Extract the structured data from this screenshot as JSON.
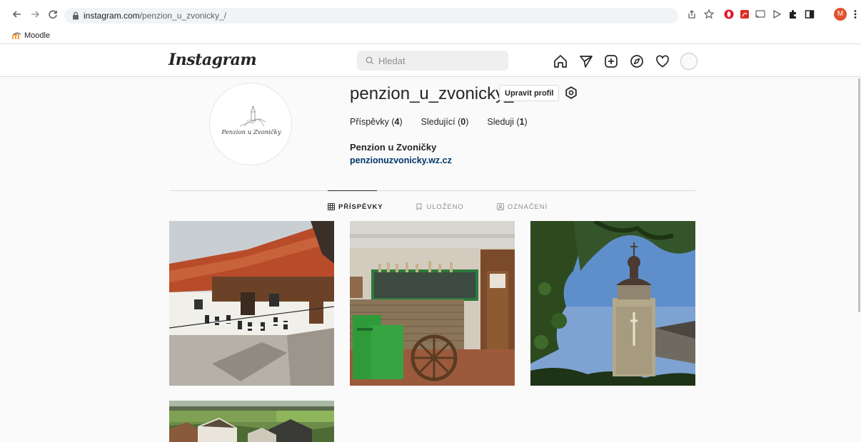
{
  "browser": {
    "url_domain": "instagram.com",
    "url_path": "/penzion_u_zvonicky_/",
    "bookmark_label": "Moodle",
    "profile_initial": "M"
  },
  "instagram": {
    "logo": "Instagram",
    "search_placeholder": "Hledat",
    "nav_icons": [
      "home-icon",
      "direct-icon",
      "new-post-icon",
      "explore-icon",
      "activity-icon",
      "profile-avatar"
    ]
  },
  "profile": {
    "username": "penzion_u_zvonicky_",
    "edit_button_label": "Upravit profil",
    "avatar_text": "Penzion u Zvoničky",
    "stats": {
      "posts_label": "Příspěvky",
      "posts_count": "4",
      "followers_label": "Sledující",
      "followers_count": "0",
      "following_label": "Sleduji",
      "following_count": "1"
    },
    "full_name": "Penzion u Zvoničky",
    "website": "penzionuzvonicky.wz.cz"
  },
  "tabs": [
    {
      "label": "PŘÍSPĚVKY",
      "icon": "grid-icon",
      "active": true
    },
    {
      "label": "ULOŽENO",
      "icon": "bookmark-icon",
      "active": false
    },
    {
      "label": "OZNAČENÍ",
      "icon": "tagged-icon",
      "active": false
    }
  ],
  "posts": [
    {
      "subject": "courtyard-building-photo"
    },
    {
      "subject": "bar-interior-photo"
    },
    {
      "subject": "bell-tower-photo"
    },
    {
      "subject": "aerial-village-photo"
    }
  ],
  "colors": {
    "link": "#00376b",
    "profile_avatar_bg": "#e0522d",
    "page_bg": "#fafafa"
  }
}
